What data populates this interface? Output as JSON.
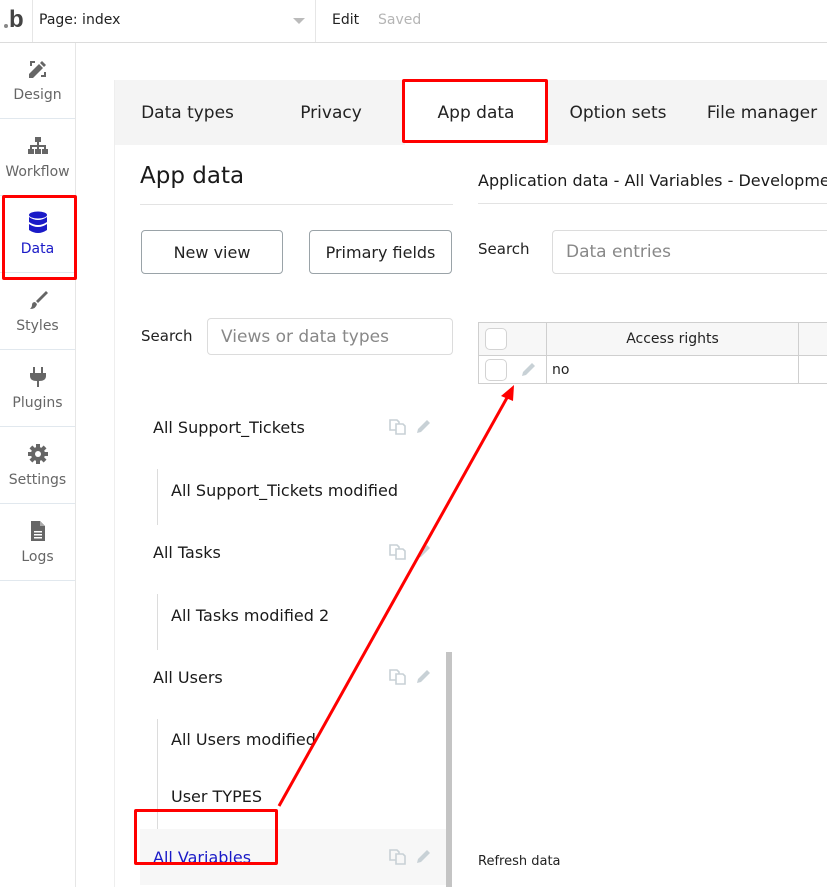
{
  "topbar": {
    "logo_text": "b",
    "page_selector_label": "Page: index",
    "edit_label": "Edit",
    "save_status": "Saved"
  },
  "sidenav": {
    "items": [
      {
        "label": "Design",
        "icon": "design-icon",
        "active": false
      },
      {
        "label": "Workflow",
        "icon": "workflow-icon",
        "active": false
      },
      {
        "label": "Data",
        "icon": "database-icon",
        "active": true
      },
      {
        "label": "Styles",
        "icon": "brush-icon",
        "active": false
      },
      {
        "label": "Plugins",
        "icon": "plug-icon",
        "active": false
      },
      {
        "label": "Settings",
        "icon": "gear-icon",
        "active": false
      },
      {
        "label": "Logs",
        "icon": "document-icon",
        "active": false
      }
    ]
  },
  "tabs": [
    {
      "label": "Data types",
      "active": false
    },
    {
      "label": "Privacy",
      "active": false
    },
    {
      "label": "App data",
      "active": true
    },
    {
      "label": "Option sets",
      "active": false
    },
    {
      "label": "File manager",
      "active": false
    }
  ],
  "left": {
    "title": "App data",
    "new_view_label": "New view",
    "primary_fields_label": "Primary fields",
    "search_label": "Search",
    "search_placeholder": "Views or data types",
    "views": [
      {
        "label": "All Support_Tickets",
        "level": "top",
        "selected": false
      },
      {
        "label": "All Support_Tickets modified",
        "level": "sub",
        "selected": false
      },
      {
        "label": "All Tasks",
        "level": "top",
        "selected": false
      },
      {
        "label": "All Tasks modified 2",
        "level": "sub",
        "selected": false
      },
      {
        "label": "All Users",
        "level": "top",
        "selected": false
      },
      {
        "label": "All Users modified",
        "level": "sub",
        "selected": false
      },
      {
        "label": "User TYPES",
        "level": "sub",
        "selected": false
      },
      {
        "label": "All Variables",
        "level": "top",
        "selected": true
      }
    ]
  },
  "right": {
    "title": "Application data - All Variables - Developme",
    "search_label": "Search",
    "search_placeholder": "Data entries",
    "table": {
      "columns": [
        "Access rights"
      ],
      "rows": [
        [
          "no"
        ]
      ]
    },
    "refresh_label": "Refresh data"
  },
  "colors": {
    "accent": "#1a1ac7",
    "annotation": "#ff0000",
    "tab_bar_bg": "#f4f4f4"
  }
}
